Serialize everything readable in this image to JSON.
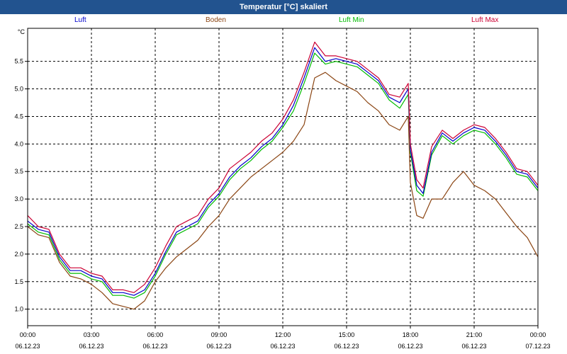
{
  "window": {
    "title": "Temperatur [°C] skaliert"
  },
  "colors": {
    "titlebar": "#22538f",
    "grid": "#000000",
    "frame": "#000000"
  },
  "chart_data": {
    "type": "line",
    "title": "Temperatur [°C] skaliert",
    "ylabel": "°C",
    "xlabel": "",
    "ylim": [
      0.7,
      6.1
    ],
    "grid": true,
    "legend_position": "top",
    "x_ticks": [
      {
        "time": "00:00",
        "date": "06.12.23"
      },
      {
        "time": "03:00",
        "date": "06.12.23"
      },
      {
        "time": "06:00",
        "date": "06.12.23"
      },
      {
        "time": "09:00",
        "date": "06.12.23"
      },
      {
        "time": "12:00",
        "date": "06.12.23"
      },
      {
        "time": "15:00",
        "date": "06.12.23"
      },
      {
        "time": "18:00",
        "date": "06.12.23"
      },
      {
        "time": "21:00",
        "date": "06.12.23"
      },
      {
        "time": "00:00",
        "date": "07.12.23"
      }
    ],
    "y_ticks": [
      "1.0",
      "1.5",
      "2.0",
      "2.5",
      "3.0",
      "3.5",
      "4.0",
      "4.5",
      "5.0",
      "5.5"
    ],
    "y_tick_values": [
      1.0,
      1.5,
      2.0,
      2.5,
      3.0,
      3.5,
      4.0,
      4.5,
      5.0,
      5.5
    ],
    "x_hours": [
      0,
      0.5,
      1,
      1.5,
      2,
      2.5,
      3,
      3.5,
      4,
      4.5,
      5,
      5.5,
      6,
      6.5,
      7,
      7.5,
      8,
      8.5,
      9,
      9.5,
      10,
      10.5,
      11,
      11.5,
      12,
      12.5,
      13,
      13.5,
      14,
      14.5,
      15,
      15.5,
      16,
      16.5,
      17,
      17.5,
      17.9,
      18,
      18.3,
      18.6,
      19,
      19.5,
      20,
      20.5,
      21,
      21.5,
      22,
      22.5,
      23,
      23.5,
      24
    ],
    "series": [
      {
        "name": "Luft",
        "color": "#0000cc",
        "values": [
          2.6,
          2.45,
          2.4,
          1.95,
          1.7,
          1.7,
          1.6,
          1.55,
          1.3,
          1.3,
          1.25,
          1.35,
          1.65,
          2.05,
          2.4,
          2.5,
          2.6,
          2.9,
          3.1,
          3.4,
          3.6,
          3.75,
          3.95,
          4.1,
          4.35,
          4.7,
          5.2,
          5.75,
          5.5,
          5.55,
          5.5,
          5.45,
          5.3,
          5.15,
          4.85,
          4.75,
          5.0,
          3.9,
          3.25,
          3.1,
          3.85,
          4.2,
          4.05,
          4.2,
          4.3,
          4.25,
          4.05,
          3.8,
          3.5,
          3.45,
          3.2
        ]
      },
      {
        "name": "Boden",
        "color": "#8b4513",
        "values": [
          2.5,
          2.35,
          2.3,
          1.85,
          1.6,
          1.55,
          1.45,
          1.3,
          1.1,
          1.05,
          1.0,
          1.15,
          1.5,
          1.75,
          1.95,
          2.1,
          2.25,
          2.5,
          2.7,
          3.0,
          3.2,
          3.4,
          3.55,
          3.7,
          3.85,
          4.05,
          4.35,
          5.2,
          5.3,
          5.15,
          5.05,
          4.95,
          4.75,
          4.6,
          4.35,
          4.25,
          4.5,
          3.3,
          2.7,
          2.65,
          3.0,
          3.0,
          3.3,
          3.5,
          3.25,
          3.15,
          3.0,
          2.75,
          2.5,
          2.3,
          1.95
        ]
      },
      {
        "name": "Luft Min",
        "color": "#00bb00",
        "values": [
          2.55,
          2.4,
          2.35,
          1.9,
          1.65,
          1.65,
          1.55,
          1.5,
          1.25,
          1.25,
          1.2,
          1.3,
          1.6,
          2.0,
          2.35,
          2.45,
          2.55,
          2.85,
          3.05,
          3.35,
          3.55,
          3.7,
          3.9,
          4.05,
          4.3,
          4.6,
          5.1,
          5.65,
          5.45,
          5.5,
          5.45,
          5.4,
          5.25,
          5.1,
          4.8,
          4.65,
          4.9,
          3.85,
          3.15,
          3.05,
          3.8,
          4.15,
          4.0,
          4.15,
          4.25,
          4.2,
          4.0,
          3.75,
          3.45,
          3.4,
          3.15
        ]
      },
      {
        "name": "Luft Max",
        "color": "#cc0033",
        "values": [
          2.7,
          2.5,
          2.45,
          2.0,
          1.75,
          1.75,
          1.65,
          1.6,
          1.35,
          1.35,
          1.3,
          1.45,
          1.75,
          2.15,
          2.5,
          2.6,
          2.7,
          3.0,
          3.2,
          3.55,
          3.7,
          3.85,
          4.05,
          4.2,
          4.45,
          4.8,
          5.3,
          5.85,
          5.6,
          5.6,
          5.55,
          5.5,
          5.35,
          5.2,
          4.9,
          4.85,
          5.1,
          4.0,
          3.35,
          3.2,
          3.95,
          4.25,
          4.1,
          4.25,
          4.35,
          4.3,
          4.1,
          3.85,
          3.55,
          3.5,
          3.25
        ]
      }
    ]
  }
}
